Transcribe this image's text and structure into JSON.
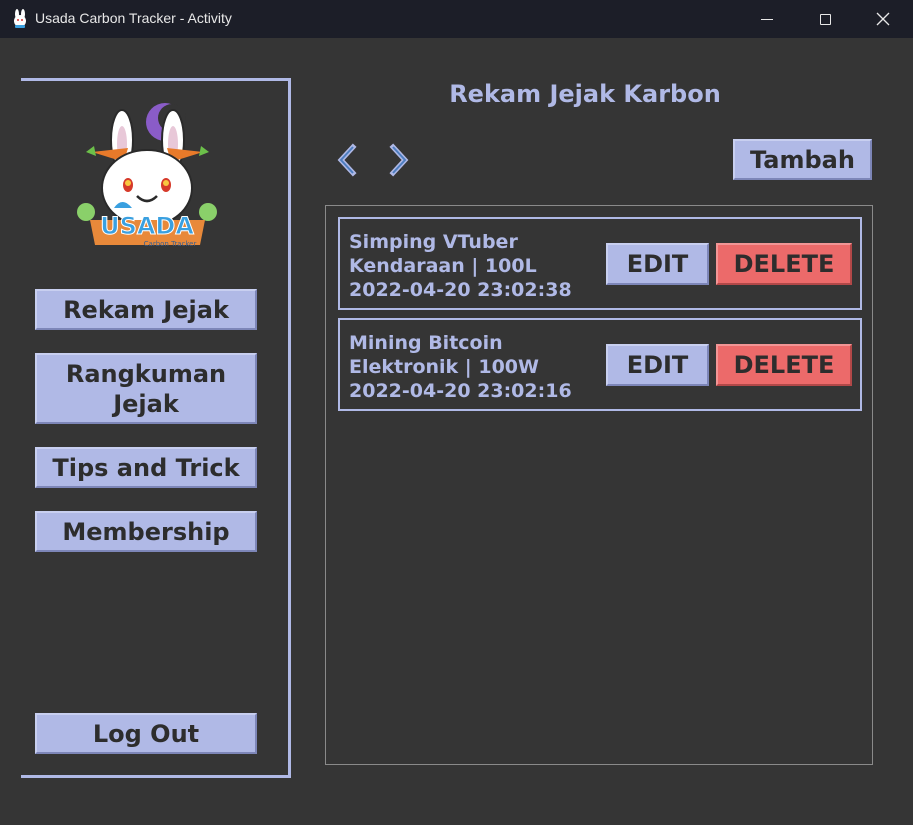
{
  "window": {
    "title": "Usada Carbon Tracker - Activity",
    "icon": "bunny-app-icon",
    "controls": [
      "minimize-icon",
      "maximize-icon",
      "close-icon"
    ]
  },
  "sidebar": {
    "logo": {
      "text": "USADA",
      "subtext": "Carbon Tracker",
      "icon": "usada-bunny-logo"
    },
    "items": [
      {
        "label": "Rekam Jejak"
      },
      {
        "label": "Rangkuman Jejak"
      },
      {
        "label": "Tips and Trick"
      },
      {
        "label": "Membership"
      }
    ],
    "logout_label": "Log Out"
  },
  "main": {
    "title": "Rekam Jejak Karbon",
    "prev_icon": "chevron-left-icon",
    "next_icon": "chevron-right-icon",
    "add_label": "Tambah",
    "records": [
      {
        "name": "Simping VTuber",
        "detail": "Kendaraan | 100L",
        "timestamp": "2022-04-20 23:02:38",
        "edit_label": "EDIT",
        "delete_label": "DELETE"
      },
      {
        "name": "Mining Bitcoin",
        "detail": "Elektronik | 100W",
        "timestamp": "2022-04-20 23:02:16",
        "edit_label": "EDIT",
        "delete_label": "DELETE"
      }
    ]
  },
  "colors": {
    "background": "#353535",
    "accent": "#b0b9e6",
    "danger": "#ec6a6a",
    "titlebar": "#1c1e28"
  }
}
